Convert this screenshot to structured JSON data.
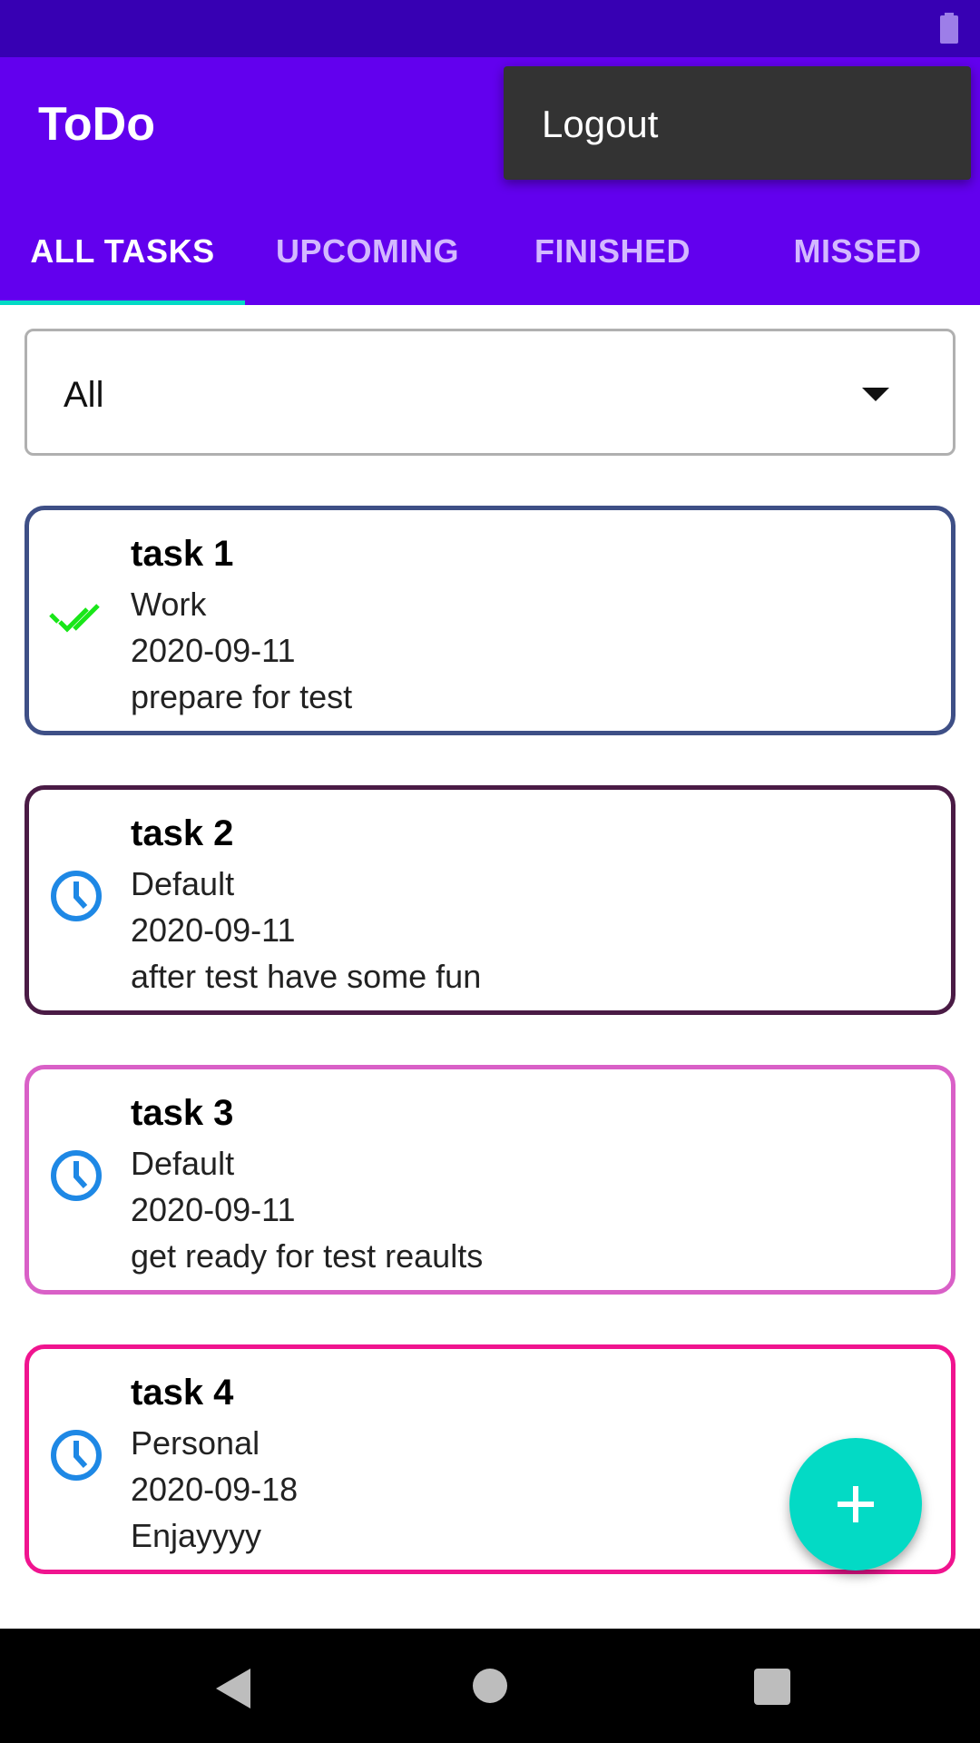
{
  "app": {
    "title": "ToDo"
  },
  "menu": {
    "logout": "Logout"
  },
  "tabs": [
    "ALL TASKS",
    "UPCOMING",
    "FINISHED",
    "MISSED"
  ],
  "filter": {
    "selected": "All"
  },
  "tasks": [
    {
      "title": "task 1",
      "category": "Work",
      "date": "2020-09-11",
      "note": "prepare for test",
      "status_icon": "double-check-icon",
      "border_color": "#3e4f86"
    },
    {
      "title": "task 2",
      "category": "Default",
      "date": "2020-09-11",
      "note": "after test have some fun",
      "status_icon": "clock-icon",
      "border_color": "#4a1b45"
    },
    {
      "title": "task 3",
      "category": "Default",
      "date": "2020-09-11",
      "note": "get ready for test reaults",
      "status_icon": "clock-icon",
      "border_color": "#d960c7"
    },
    {
      "title": "task 4",
      "category": "Personal",
      "date": "2020-09-18",
      "note": "Enjayyyy",
      "status_icon": "clock-icon",
      "border_color": "#f0148f"
    }
  ],
  "colors": {
    "primary": "#6200ee",
    "primary_dark": "#3700b3",
    "accent": "#03dac5",
    "done": "#19e619",
    "pending": "#1e88e5"
  }
}
